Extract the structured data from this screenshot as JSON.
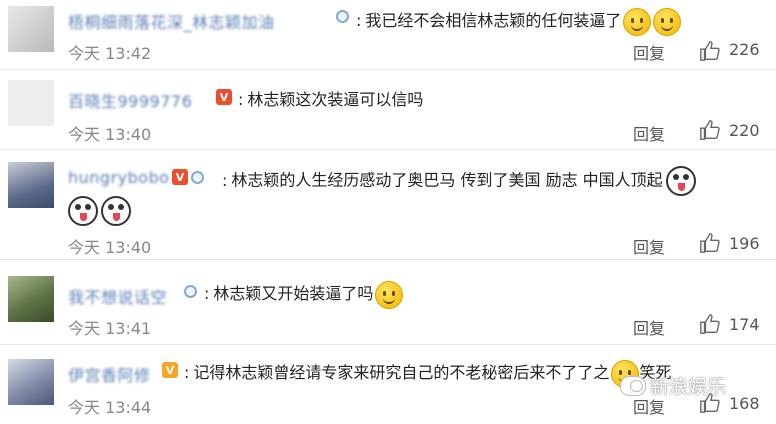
{
  "comments": [
    {
      "username": "梧桐细雨落花深_林志颖加油",
      "text": "我已经不会相信林志颖的任何装逼了",
      "emoji": [
        "smile",
        "smile"
      ],
      "time": "今天 13:42",
      "reply": "回复",
      "likes": "226",
      "badge": "ring"
    },
    {
      "username": "百晓生9999776",
      "text": "林志颖这次装逼可以信吗",
      "emoji": [],
      "time": "今天 13:40",
      "reply": "回复",
      "likes": "220",
      "badge": "vip"
    },
    {
      "username": "hungrybobo",
      "text": "林志颖的人生经历感动了奥巴马 传到了美国 励志 中国人顶起",
      "text_line2_emoji": [
        "husky",
        "husky"
      ],
      "emoji": [
        "husky"
      ],
      "time": "今天 13:40",
      "reply": "回复",
      "likes": "196",
      "badge": "vip+ring"
    },
    {
      "username": "我不想说话空",
      "text": "林志颖又开始装逼了吗",
      "emoji": [
        "smile"
      ],
      "time": "今天 13:41",
      "reply": "回复",
      "likes": "174",
      "badge": "ring"
    },
    {
      "username": "伊宫香阿修",
      "text": "记得林志颖曾经请专家来研究自己的不老秘密后来不了了之",
      "suffix": "笑死",
      "emoji": [
        "smile"
      ],
      "time": "今天 13:44",
      "reply": "回复",
      "likes": "168",
      "badge": "vip-gold"
    }
  ],
  "watermark": "新浪娱乐",
  "colors": {
    "username": "#5a7fb5",
    "text": "#222222",
    "meta": "#888888",
    "vip": "#f04d2e",
    "vip_gold": "#f5a623"
  }
}
